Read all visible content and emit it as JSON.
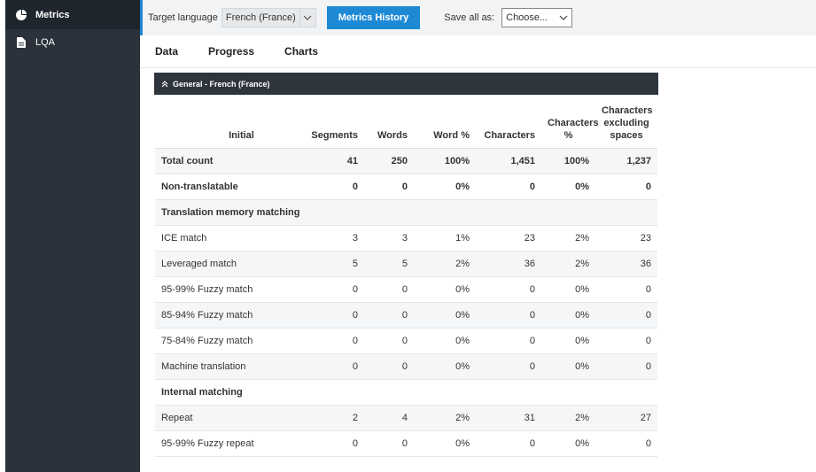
{
  "sidebar": {
    "items": [
      {
        "label": "Metrics",
        "icon": "pie-chart-icon",
        "active": true
      },
      {
        "label": "LQA",
        "icon": "document-icon",
        "active": false
      }
    ]
  },
  "toolbar": {
    "target_language_label": "Target language",
    "target_language_value": "French (France)",
    "metrics_history_label": "Metrics History",
    "save_all_label": "Save all as:",
    "save_all_value": "Choose..."
  },
  "tabs": [
    {
      "label": "Data",
      "active": true
    },
    {
      "label": "Progress",
      "active": false
    },
    {
      "label": "Charts",
      "active": false
    }
  ],
  "panel": {
    "title": "General - French (France)"
  },
  "table": {
    "headers": [
      "Initial",
      "Segments",
      "Words",
      "Word %",
      "Characters",
      "Characters %",
      "Characters excluding spaces"
    ],
    "rows": [
      {
        "type": "data",
        "bold": true,
        "cells": [
          "Total count",
          "41",
          "250",
          "100%",
          "1,451",
          "100%",
          "1,237"
        ]
      },
      {
        "type": "data",
        "bold": true,
        "cells": [
          "Non-translatable",
          "0",
          "0",
          "0%",
          "0",
          "0%",
          "0"
        ]
      },
      {
        "type": "section",
        "cells": [
          "Translation memory matching"
        ]
      },
      {
        "type": "data",
        "bold": false,
        "cells": [
          "ICE match",
          "3",
          "3",
          "1%",
          "23",
          "2%",
          "23"
        ]
      },
      {
        "type": "data",
        "bold": false,
        "cells": [
          "Leveraged match",
          "5",
          "5",
          "2%",
          "36",
          "2%",
          "36"
        ]
      },
      {
        "type": "data",
        "bold": false,
        "cells": [
          "95-99% Fuzzy match",
          "0",
          "0",
          "0%",
          "0",
          "0%",
          "0"
        ]
      },
      {
        "type": "data",
        "bold": false,
        "cells": [
          "85-94% Fuzzy match",
          "0",
          "0",
          "0%",
          "0",
          "0%",
          "0"
        ]
      },
      {
        "type": "data",
        "bold": false,
        "cells": [
          "75-84% Fuzzy match",
          "0",
          "0",
          "0%",
          "0",
          "0%",
          "0"
        ]
      },
      {
        "type": "data",
        "bold": false,
        "cells": [
          "Machine translation",
          "0",
          "0",
          "0%",
          "0",
          "0%",
          "0"
        ]
      },
      {
        "type": "section",
        "cells": [
          "Internal matching"
        ]
      },
      {
        "type": "data",
        "bold": false,
        "cells": [
          "Repeat",
          "2",
          "4",
          "2%",
          "31",
          "2%",
          "27"
        ]
      },
      {
        "type": "data",
        "bold": false,
        "cells": [
          "95-99% Fuzzy repeat",
          "0",
          "0",
          "0%",
          "0",
          "0%",
          "0"
        ]
      }
    ]
  }
}
